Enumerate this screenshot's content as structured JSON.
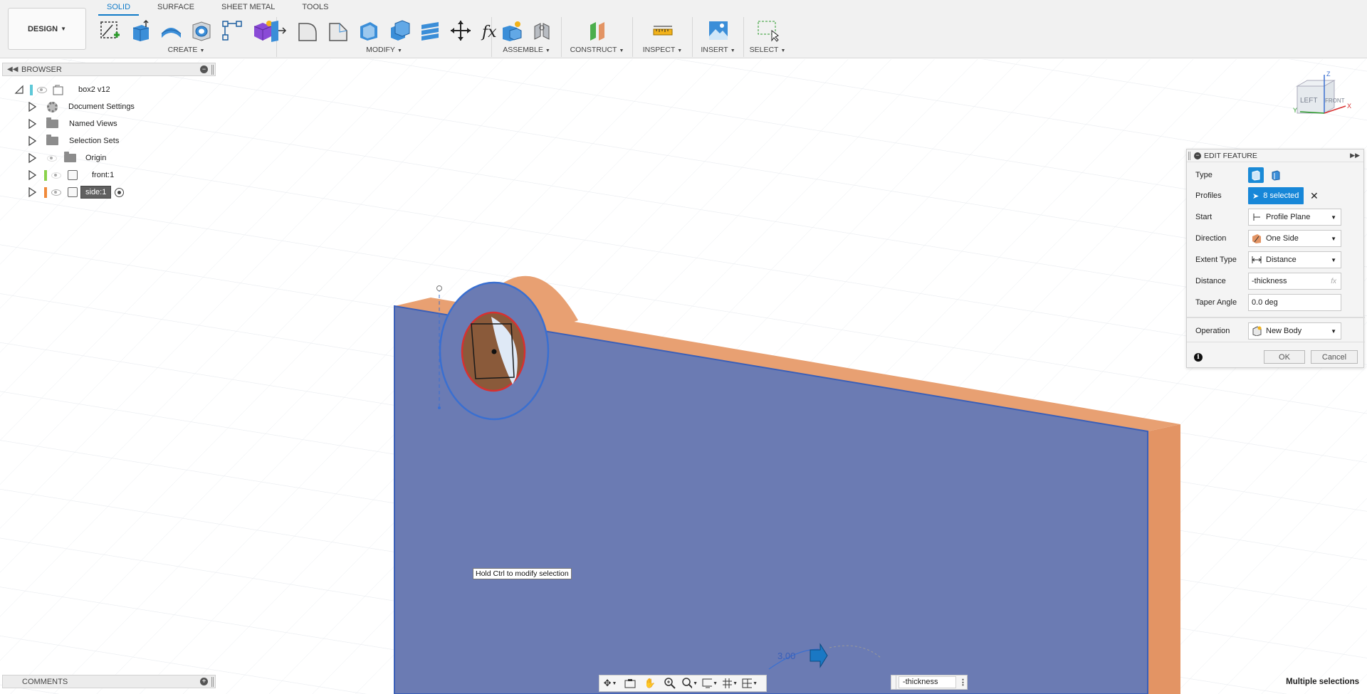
{
  "toolbar": {
    "workspace": "DESIGN",
    "tabs": [
      "SOLID",
      "SURFACE",
      "SHEET METAL",
      "TOOLS"
    ],
    "groups": {
      "create": "CREATE",
      "modify": "MODIFY",
      "assemble": "ASSEMBLE",
      "construct": "CONSTRUCT",
      "inspect": "INSPECT",
      "insert": "INSERT",
      "select": "SELECT"
    }
  },
  "browser": {
    "title": "BROWSER",
    "items": [
      {
        "label": "box2 v12"
      },
      {
        "label": "Document Settings"
      },
      {
        "label": "Named Views"
      },
      {
        "label": "Selection Sets"
      },
      {
        "label": "Origin"
      },
      {
        "label": "front:1"
      },
      {
        "label": "side:1"
      }
    ]
  },
  "comments": {
    "title": "COMMENTS"
  },
  "edit_feature": {
    "title": "EDIT FEATURE",
    "type_label": "Type",
    "profiles_label": "Profiles",
    "profiles_value": "8 selected",
    "start_label": "Start",
    "start_value": "Profile Plane",
    "direction_label": "Direction",
    "direction_value": "One Side",
    "extent_type_label": "Extent Type",
    "extent_type_value": "Distance",
    "distance_label": "Distance",
    "distance_value": "-thickness",
    "taper_label": "Taper Angle",
    "taper_value": "0.0 deg",
    "operation_label": "Operation",
    "operation_value": "New Body",
    "ok_label": "OK",
    "cancel_label": "Cancel",
    "fx_label": "fx"
  },
  "viewport": {
    "tooltip": "Hold Ctrl to modify selection",
    "dimension_value": "3.00",
    "expression_value": "-thickness",
    "viewcube": {
      "left": "LEFT",
      "front": "FRONT",
      "z": "Z",
      "x": "X",
      "y": "Y"
    }
  },
  "status": {
    "text": "Multiple selections"
  },
  "colors": {
    "accent": "#0f7ac8",
    "face_blue": "#6b7bb3",
    "edge_orange": "#e39464",
    "selection_blue": "#1787d8"
  }
}
